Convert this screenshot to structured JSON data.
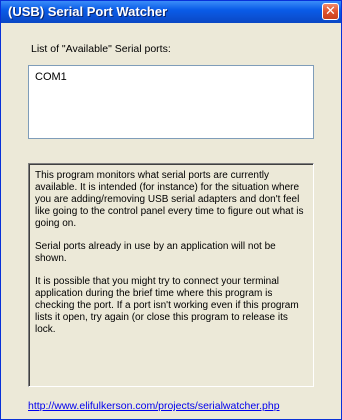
{
  "window": {
    "title": "(USB) Serial Port Watcher",
    "close_glyph": "✕"
  },
  "ports": {
    "label": "List of \"Available\" Serial ports:",
    "items": [
      "COM1"
    ]
  },
  "info": {
    "paragraphs": [
      "This program monitors what serial ports are currently available.  It is intended (for instance) for the situation where you are adding/removing USB serial adapters and don't feel like going to the control panel every time to figure out what is going on.",
      "Serial ports already in use by an application will not be shown.",
      "It is possible that you might try to connect your terminal application during the brief time where this program is checking the port.  If a port isn't working even if this program lists it open, try again (or close this program to release its lock."
    ]
  },
  "footer": {
    "link_text": "http://www.elifulkerson.com/projects/serialwatcher.php"
  },
  "colors": {
    "titlebar": "#0a5ce8",
    "window_bg": "#ece9d8",
    "close_button": "#e0522d",
    "link": "#0000ee"
  }
}
